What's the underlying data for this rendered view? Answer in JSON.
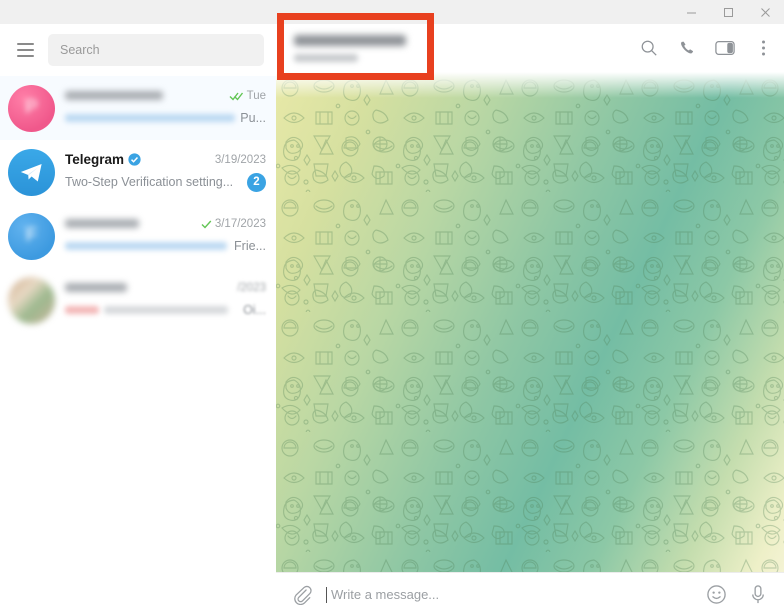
{
  "window": {
    "controls": [
      {
        "name": "minimize",
        "glyph": "minimize-icon"
      },
      {
        "name": "maximize",
        "glyph": "maximize-icon"
      },
      {
        "name": "close",
        "glyph": "close-icon"
      }
    ]
  },
  "sidebar": {
    "menu_icon": "hamburger-menu-icon",
    "search": {
      "placeholder": "Search",
      "value": ""
    },
    "chats": [
      {
        "name": "",
        "name_blurred": true,
        "verified": false,
        "date": "Tue",
        "ticks": "double-check",
        "preview": "Pu...",
        "preview_blurred": true,
        "unread": "",
        "avatar_letter": "P",
        "avatar_kind": "letter-pink",
        "selected": true
      },
      {
        "name": "Telegram",
        "name_blurred": false,
        "verified": true,
        "date": "3/19/2023",
        "ticks": "",
        "preview": "Two-Step Verification setting...",
        "preview_blurred": false,
        "unread": "2",
        "avatar_letter": "",
        "avatar_kind": "telegram-logo",
        "selected": false
      },
      {
        "name": "",
        "name_blurred": true,
        "verified": false,
        "date": "3/17/2023",
        "ticks": "single-check",
        "preview": "Frie...",
        "preview_blurred": true,
        "unread": "",
        "avatar_letter": "F",
        "avatar_kind": "letter-blue",
        "selected": false
      },
      {
        "name": "",
        "name_blurred": true,
        "verified": false,
        "date": "/2023",
        "ticks": "",
        "preview": "Oi...",
        "preview_blurred": true,
        "unread": "",
        "avatar_letter": "",
        "avatar_kind": "photo",
        "selected": false
      }
    ]
  },
  "chat_header": {
    "title": "",
    "title_blurred": true,
    "subtitle": "",
    "subtitle_blurred": true,
    "actions": [
      {
        "name": "search-icon"
      },
      {
        "name": "call-icon"
      },
      {
        "name": "toggle-info-panel-icon"
      },
      {
        "name": "more-options-icon"
      }
    ]
  },
  "conversation": {
    "messages": [],
    "wallpaper": "telegram-doodle-pattern"
  },
  "composer": {
    "attach_icon": "paperclip-icon",
    "placeholder": "Write a message...",
    "value": "",
    "emoji_icon": "emoji-smiley-icon",
    "mic_icon": "microphone-icon"
  },
  "annotation": {
    "shape": "rectangle",
    "color": "#e8401f",
    "target": "chat-header-title"
  }
}
